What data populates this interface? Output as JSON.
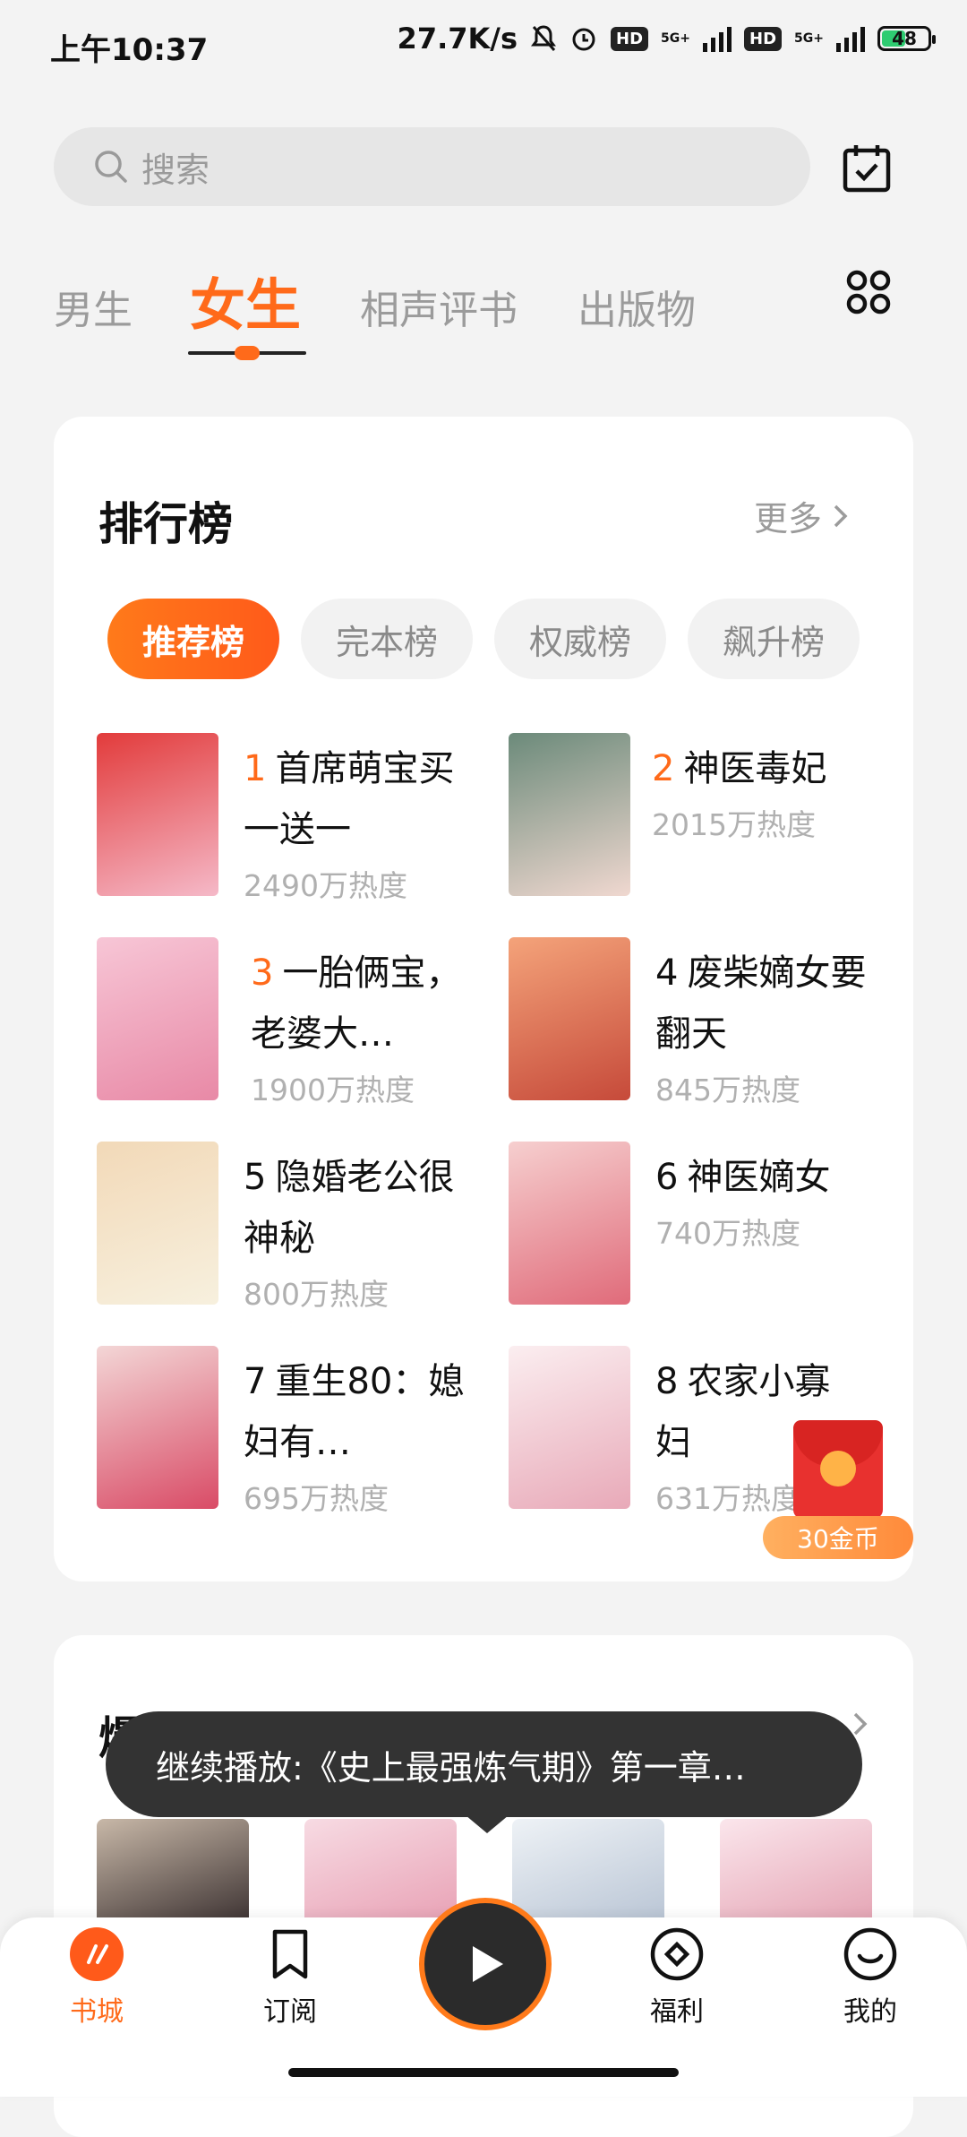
{
  "status_bar": {
    "time": "上午10:37",
    "speed": "27.7K/s",
    "battery": "48",
    "hd1": "HD",
    "hd2": "HD",
    "net1": "5G+",
    "net2": "5G+"
  },
  "search": {
    "placeholder": "搜索"
  },
  "tabs": [
    {
      "label": "男生"
    },
    {
      "label": "女生"
    },
    {
      "label": "相声评书"
    },
    {
      "label": "出版物"
    }
  ],
  "ranking": {
    "title": "排行榜",
    "more": "更多",
    "pills": [
      {
        "label": "推荐榜"
      },
      {
        "label": "完本榜"
      },
      {
        "label": "权威榜"
      },
      {
        "label": "飙升榜"
      }
    ],
    "books": [
      {
        "rank": "1",
        "title": "首席萌宝买一送一",
        "heat": "2490万热度"
      },
      {
        "rank": "2",
        "title": "神医毒妃",
        "heat": "2015万热度"
      },
      {
        "rank": "3",
        "title": "一胎俩宝，老婆大…",
        "heat": "1900万热度"
      },
      {
        "rank": "4",
        "title": "废柴嫡女要翻天",
        "heat": "845万热度"
      },
      {
        "rank": "5",
        "title": "隐婚老公很神秘",
        "heat": "800万热度"
      },
      {
        "rank": "6",
        "title": "神医嫡女",
        "heat": "740万热度"
      },
      {
        "rank": "7",
        "title": "重生80：媳妇有…",
        "heat": "695万热度"
      },
      {
        "rank": "8",
        "title": "农家小寡妇",
        "heat": "631万热度"
      }
    ]
  },
  "reward": {
    "coins": "30金币"
  },
  "section2": {
    "title_partial": "爆"
  },
  "toast": {
    "text": "继续播放:《史上最强炼气期》第一章…"
  },
  "nav": [
    {
      "label": "书城"
    },
    {
      "label": "订阅"
    },
    {
      "label": "福利"
    },
    {
      "label": "我的"
    }
  ],
  "colors": {
    "accent": "#ff6a1a"
  }
}
